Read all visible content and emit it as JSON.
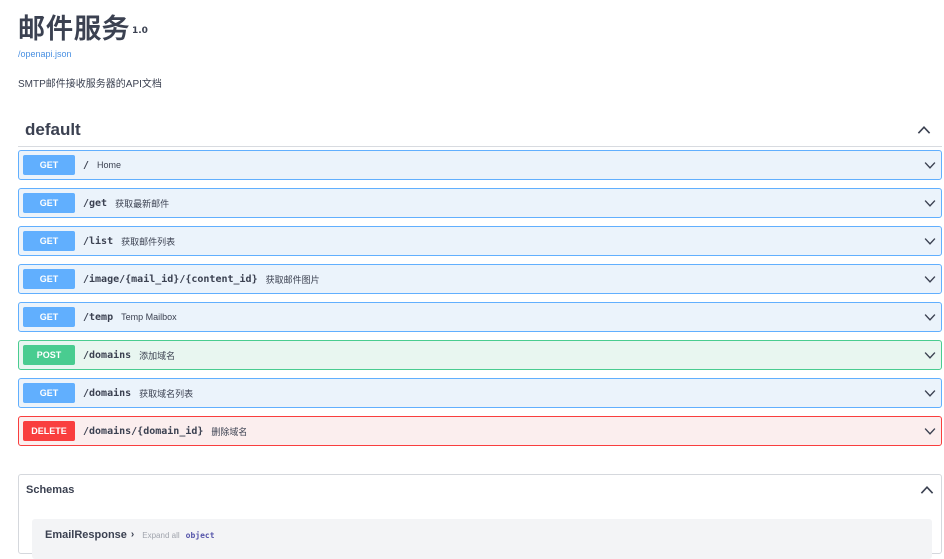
{
  "info": {
    "title": "邮件服务",
    "version_badge": "1.0",
    "spec_link": "/openapi.json",
    "description": "SMTP邮件接收服务器的API文档"
  },
  "tag": {
    "name": "default",
    "toggle_icon": "chevron-up-icon"
  },
  "operations": [
    {
      "method": "GET",
      "kind": "get",
      "path": "/",
      "summary": "Home"
    },
    {
      "method": "GET",
      "kind": "get",
      "path": "/get",
      "summary": "获取最新邮件"
    },
    {
      "method": "GET",
      "kind": "get",
      "path": "/list",
      "summary": "获取邮件列表"
    },
    {
      "method": "GET",
      "kind": "get",
      "path": "/image/{mail_id}/{content_id}",
      "summary": "获取邮件图片"
    },
    {
      "method": "GET",
      "kind": "get",
      "path": "/temp",
      "summary": "Temp Mailbox"
    },
    {
      "method": "POST",
      "kind": "post",
      "path": "/domains",
      "summary": "添加域名"
    },
    {
      "method": "GET",
      "kind": "get",
      "path": "/domains",
      "summary": "获取域名列表"
    },
    {
      "method": "DELETE",
      "kind": "delete",
      "path": "/domains/{domain_id}",
      "summary": "删除域名"
    }
  ],
  "schemas": {
    "title": "Schemas",
    "models": [
      {
        "name": "EmailResponse",
        "arrow": "›",
        "expand_label": "Expand all",
        "type": "object"
      }
    ]
  },
  "colors": {
    "get": "#61affe",
    "post": "#49cc90",
    "delete": "#f93e3e",
    "text": "#3b4151",
    "link": "#4990e2"
  }
}
